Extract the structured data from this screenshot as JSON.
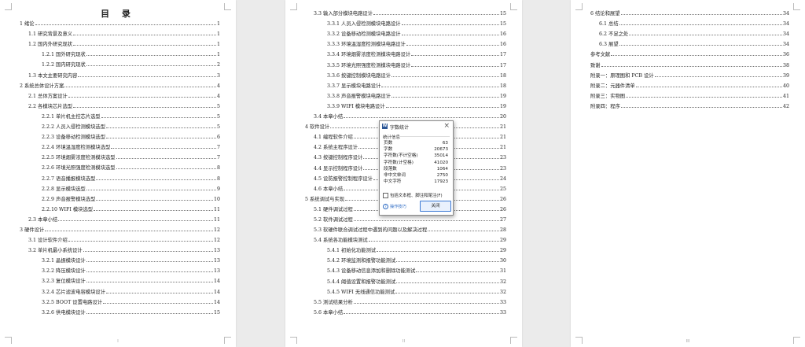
{
  "toc_heading": "目 录",
  "page1": {
    "footer": "I",
    "entries": [
      {
        "level": 1,
        "title": "1 绪论",
        "page": "1"
      },
      {
        "level": 2,
        "title": "1.1 研究背景及意义",
        "page": "1"
      },
      {
        "level": 2,
        "title": "1.2 国内外研究现状",
        "page": "1"
      },
      {
        "level": 3,
        "title": "1.2.1 国外研究现状",
        "page": "1"
      },
      {
        "level": 3,
        "title": "1.2.2 国内研究现状",
        "page": "2"
      },
      {
        "level": 2,
        "title": "1.3 本文主要研究内容",
        "page": "3"
      },
      {
        "level": 1,
        "title": "2 系统总体设计方案",
        "page": "4"
      },
      {
        "level": 2,
        "title": "2.1 总体方案设计",
        "page": "4"
      },
      {
        "level": 2,
        "title": "2.2 各模块芯片选型",
        "page": "5"
      },
      {
        "level": 3,
        "title": "2.2.1 单片机主控芯片选型",
        "page": "5"
      },
      {
        "level": 3,
        "title": "2.2.2 人员入侵检测模块选型",
        "page": "5"
      },
      {
        "level": 3,
        "title": "2.2.3 设备移动检测模块选型",
        "page": "6"
      },
      {
        "level": 3,
        "title": "2.2.4 环境温湿度检测模块选型",
        "page": "7"
      },
      {
        "level": 3,
        "title": "2.2.5 环境烟雾浓度检测模块选型",
        "page": "7"
      },
      {
        "level": 3,
        "title": "2.2.6 环境光照强度检测模块选型",
        "page": "8"
      },
      {
        "level": 3,
        "title": "2.2.7 语音播报模块选型",
        "page": "8"
      },
      {
        "level": 3,
        "title": "2.2.8 显示模块选型",
        "page": "9"
      },
      {
        "level": 3,
        "title": "2.2.9 声音报警模块选型",
        "page": "10"
      },
      {
        "level": 3,
        "title": "2.2.10 WIFI 模块选型",
        "page": "11"
      },
      {
        "level": 2,
        "title": "2.3 本章小结",
        "page": "11"
      },
      {
        "level": 1,
        "title": "3 硬件设计",
        "page": "12"
      },
      {
        "level": 2,
        "title": "3.1 设计软件介绍",
        "page": "12"
      },
      {
        "level": 2,
        "title": "3.2 单片机最小系统设计",
        "page": "13"
      },
      {
        "level": 3,
        "title": "3.2.1 晶振模块设计",
        "page": "13"
      },
      {
        "level": 3,
        "title": "3.2.2 降压模块设计",
        "page": "13"
      },
      {
        "level": 3,
        "title": "3.2.3 复位模块设计",
        "page": "14"
      },
      {
        "level": 3,
        "title": "3.2.4 芯片滤波电容模块设计",
        "page": "14"
      },
      {
        "level": 3,
        "title": "3.2.5 BOOT 设置电路设计",
        "page": "14"
      },
      {
        "level": 3,
        "title": "3.2.6 供电模块设计",
        "page": "15"
      }
    ]
  },
  "page2": {
    "footer": "II",
    "entries": [
      {
        "level": 2,
        "title": "3.3 输入部分模块电路设计",
        "page": "15"
      },
      {
        "level": 3,
        "title": "3.3.1 人员入侵检测模块电路设计",
        "page": "15"
      },
      {
        "level": 3,
        "title": "3.3.2 设备移动检测模块电路设计",
        "page": "16"
      },
      {
        "level": 3,
        "title": "3.3.3 环境温湿度检测模块电路设计",
        "page": "16"
      },
      {
        "level": 3,
        "title": "3.3.4 环境烟雾浓度检测模块电路设计",
        "page": "17"
      },
      {
        "level": 3,
        "title": "3.3.5 环境光照强度检测模块电路设计",
        "page": "17"
      },
      {
        "level": 3,
        "title": "3.3.6 按键控制模块电路设计",
        "page": "18"
      },
      {
        "level": 3,
        "title": "3.3.7 显示模块电路设计",
        "page": "18"
      },
      {
        "level": 3,
        "title": "3.3.8 声音报警模块电路设计",
        "page": "19"
      },
      {
        "level": 3,
        "title": "3.3.9 WIFI 模块电路设计",
        "page": "19"
      },
      {
        "level": 2,
        "title": "3.4 本章小结",
        "page": "20"
      },
      {
        "level": 1,
        "title": "4 软件设计",
        "page": "21"
      },
      {
        "level": 2,
        "title": "4.1 编程软件介绍",
        "page": "21"
      },
      {
        "level": 2,
        "title": "4.2 系统主程序设计",
        "page": "21"
      },
      {
        "level": 2,
        "title": "4.3 按键控制程序设计",
        "page": "23"
      },
      {
        "level": 2,
        "title": "4.4 显示控制程序设计",
        "page": "23"
      },
      {
        "level": 2,
        "title": "4.5 设防报警控制程序设计",
        "page": "24"
      },
      {
        "level": 2,
        "title": "4.6 本章小结",
        "page": "25"
      },
      {
        "level": 1,
        "title": "5 系统调试与实现",
        "page": "26"
      },
      {
        "level": 2,
        "title": "5.1 硬件调试过程",
        "page": "26"
      },
      {
        "level": 2,
        "title": "5.2 软件调试过程",
        "page": "27"
      },
      {
        "level": 2,
        "title": "5.3 软硬件联合调试过程中遇到的问题以及解决过程",
        "page": "28"
      },
      {
        "level": 2,
        "title": "5.4 系统各功能模块测试",
        "page": "29"
      },
      {
        "level": 3,
        "title": "5.4.1 初始化功能测试",
        "page": "29"
      },
      {
        "level": 3,
        "title": "5.4.2 环境监测和报警功能测试",
        "page": "30"
      },
      {
        "level": 3,
        "title": "5.4.3 设备移动信息添加和删除功能测试",
        "page": "31"
      },
      {
        "level": 3,
        "title": "5.4.4 阈值设置和报警功能测试",
        "page": "32"
      },
      {
        "level": 3,
        "title": "5.4.5 WIFI 无线通信功能测试",
        "page": "32"
      },
      {
        "level": 2,
        "title": "5.5 测试结果分析",
        "page": "33"
      },
      {
        "level": 2,
        "title": "5.6 本章小结",
        "page": "33"
      }
    ]
  },
  "page3": {
    "footer": "III",
    "entries": [
      {
        "level": 1,
        "title": "6 结论和展望",
        "page": "34"
      },
      {
        "level": 2,
        "title": "6.1 总结",
        "page": "34"
      },
      {
        "level": 2,
        "title": "6.2 不足之处",
        "page": "34"
      },
      {
        "level": 2,
        "title": "6.3 展望",
        "page": "34"
      },
      {
        "level": 1,
        "title": "参考文献",
        "page": "36"
      },
      {
        "level": 1,
        "title": "致谢",
        "page": "38"
      },
      {
        "level": 1,
        "title": "附录一：原理图和 PCB 设计",
        "page": "39"
      },
      {
        "level": 1,
        "title": "附录二：元器件清单",
        "page": "40"
      },
      {
        "level": 1,
        "title": "附录三：实物图",
        "page": "41"
      },
      {
        "level": 1,
        "title": "附录四：程序",
        "page": "42"
      }
    ]
  },
  "dialog": {
    "title": "字数统计",
    "app_icon": "W",
    "close": "×",
    "section": "统计信息",
    "stats": [
      {
        "label": "页数",
        "value": "63"
      },
      {
        "label": "字数",
        "value": "20673"
      },
      {
        "label": "字符数(不计空格)",
        "value": "35014"
      },
      {
        "label": "字符数(计空格)",
        "value": "41020"
      },
      {
        "label": "段落数",
        "value": "1064"
      },
      {
        "label": "非中文单词",
        "value": "2750"
      },
      {
        "label": "中文字符",
        "value": "17923"
      }
    ],
    "checkbox_label": "包括文本框、脚注和尾注(F)",
    "tips_label": "操作技巧",
    "close_button": "关闭"
  }
}
